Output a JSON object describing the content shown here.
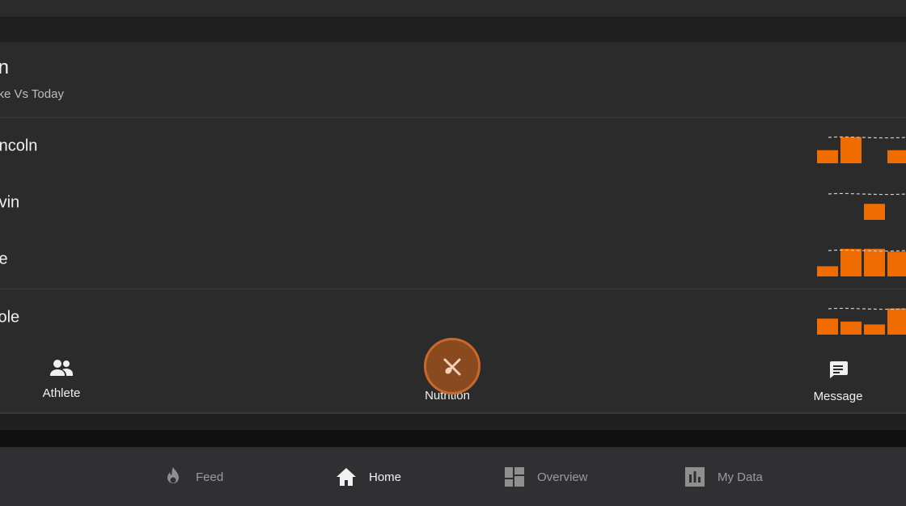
{
  "card": {
    "title": "ion",
    "subtitle": "take Vs Today",
    "rows": [
      {
        "name": "Lincoln",
        "bars": [
          0.45,
          0.9,
          0.0,
          0.45
        ]
      },
      {
        "name": "alvin",
        "bars": [
          0.0,
          0.0,
          0.55,
          0.0
        ]
      },
      {
        "name": "rlie",
        "bars": [
          0.35,
          0.95,
          0.95,
          0.85
        ]
      },
      {
        "name": "Cole",
        "bars": [
          0.55,
          0.45,
          0.35,
          0.9
        ]
      }
    ]
  },
  "actions": {
    "athlete_label": "Athlete",
    "nutrition_label": "Nutrition",
    "message_label": "Message"
  },
  "bottom_nav": {
    "feed_label": "Feed",
    "home_label": "Home",
    "overview_label": "Overview",
    "mydata_label": "My Data"
  },
  "colors": {
    "accent": "#ef6c00",
    "fab_fill": "#8a4a1f",
    "fab_border": "#c8682b"
  }
}
